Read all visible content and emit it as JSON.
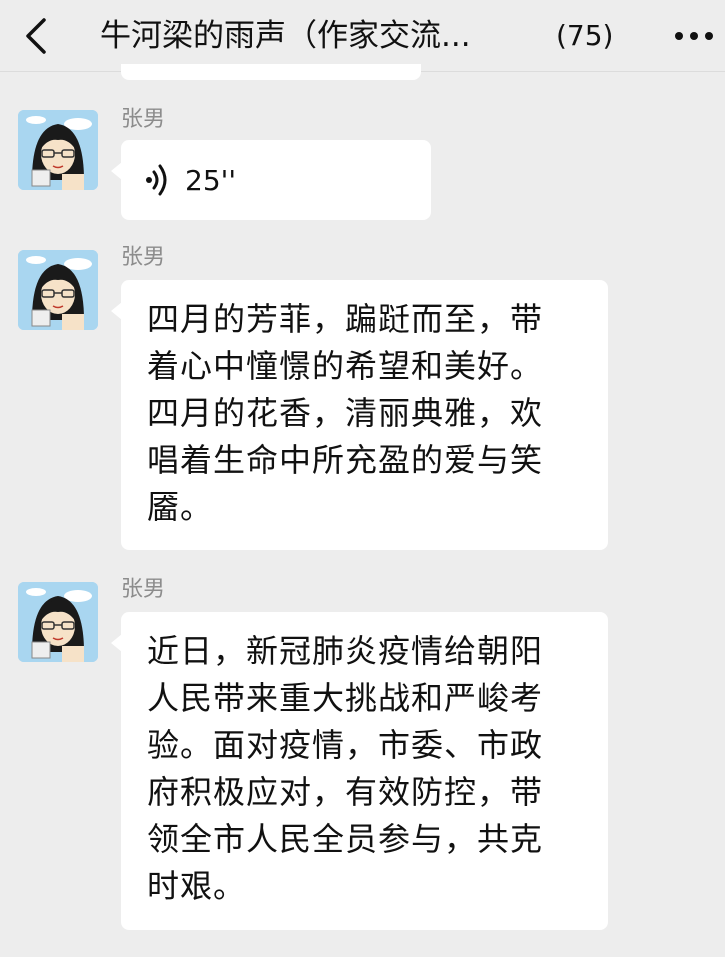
{
  "header": {
    "back_icon": "chevron-left-icon",
    "title": "牛河梁的雨声（作家交流...",
    "member_count": "(75)",
    "more_icon": "more-dots-icon"
  },
  "messages": [
    {
      "sender": "张男",
      "avatar": "cartoon-woman-avatar",
      "type": "voice",
      "voice_icon": "voice-waves-icon",
      "duration": "25''"
    },
    {
      "sender": "张男",
      "avatar": "cartoon-woman-avatar",
      "type": "text",
      "text": "四月的芳菲，蹁跹而至，带\n着心中憧憬的希望和美好。\n四月的花香，清丽典雅，欢\n唱着生命中所充盈的爱与笑\n靥。"
    },
    {
      "sender": "张男",
      "avatar": "cartoon-woman-avatar",
      "type": "text",
      "text": "近日，新冠肺炎疫情给朝阳\n人民带来重大挑战和严峻考\n验。面对疫情，市委、市政\n府积极应对，有效防控，带\n领全市人民全员参与，共克\n时艰。"
    }
  ]
}
